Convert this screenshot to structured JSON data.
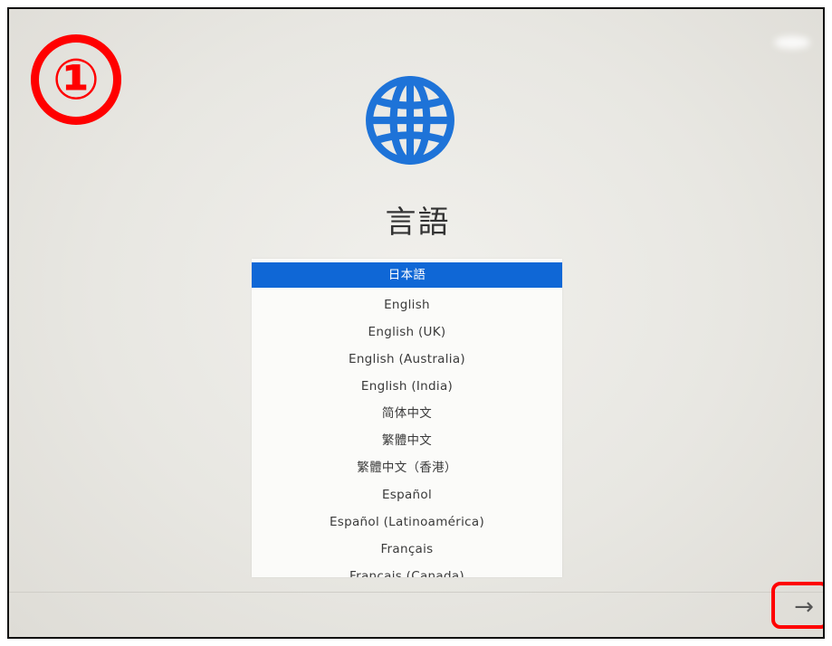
{
  "step_badge": "①",
  "page": {
    "title": "言語"
  },
  "globe": {
    "icon": "globe-icon",
    "color": "#1e73d8"
  },
  "languages": {
    "selected_index": 0,
    "items": [
      "日本語",
      "English",
      "English (UK)",
      "English (Australia)",
      "English (India)",
      "简体中文",
      "繁體中文",
      "繁體中文（香港）",
      "Español",
      "Español (Latinoamérica)",
      "Français",
      "Français (Canada)"
    ]
  },
  "navigation": {
    "next_icon": "arrow-right-icon",
    "next_glyph": "→",
    "highlight_color": "#ff0000"
  },
  "colors": {
    "selection": "#0f67d6",
    "badge": "#ff0000"
  }
}
